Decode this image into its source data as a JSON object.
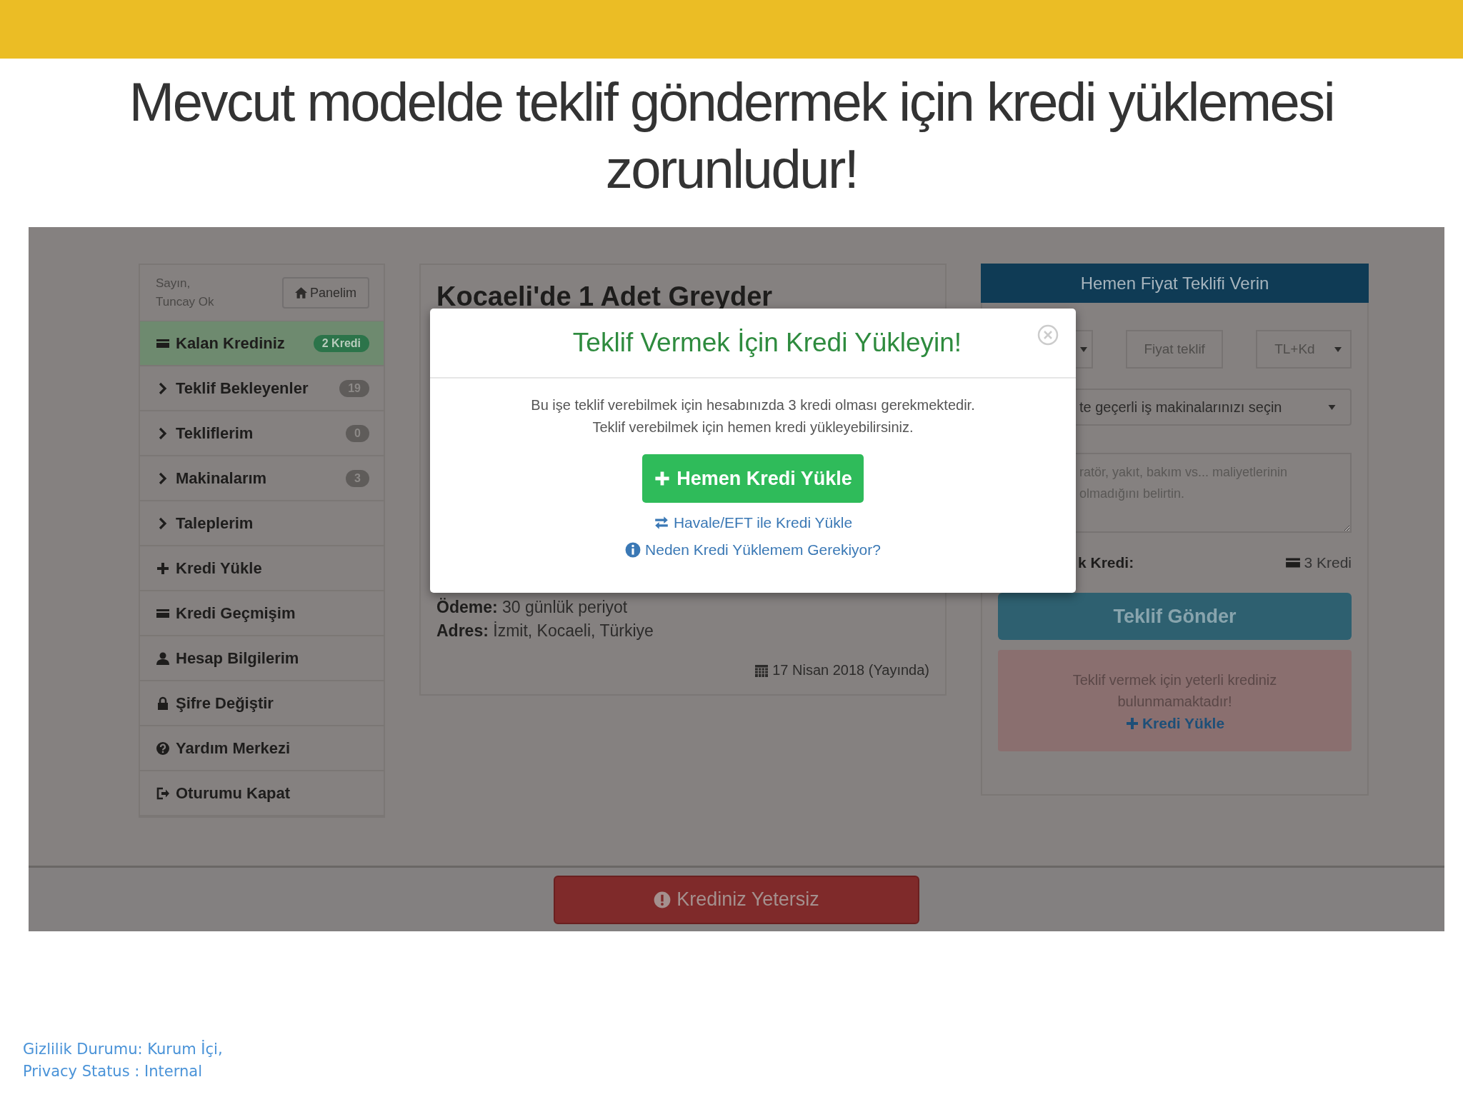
{
  "slide": {
    "title": "Mevcut modelde teklif göndermek için kredi yüklemesi zorunludur!",
    "footer": [
      "Gizlilik Durumu: Kurum İçi,",
      "Privacy Status : Internal"
    ]
  },
  "sidebar": {
    "greeting": "Sayın,",
    "user": "Tuncay Ok",
    "home_button": "Panelim",
    "items": [
      {
        "kind": "card",
        "label": "Kalan Krediniz",
        "badge": "2 Kredi",
        "selected": true
      },
      {
        "kind": "chevron",
        "label": "Teklif Bekleyenler",
        "badge": "19",
        "selected": false
      },
      {
        "kind": "chevron",
        "label": "Tekliflerim",
        "badge": "0",
        "selected": false
      },
      {
        "kind": "chevron",
        "label": "Makinalarım",
        "badge": "3",
        "selected": false
      },
      {
        "kind": "chevron",
        "label": "Taleplerim",
        "selected": false
      },
      {
        "kind": "plus",
        "label": "Kredi Yükle",
        "selected": false
      },
      {
        "kind": "card",
        "label": "Kredi Geçmişim",
        "selected": false
      },
      {
        "kind": "user",
        "label": "Hesap Bilgilerim",
        "selected": false
      },
      {
        "kind": "lock",
        "label": "Şifre Değiştir",
        "selected": false
      },
      {
        "kind": "help",
        "label": "Yardım Merkezi",
        "selected": false
      },
      {
        "kind": "logout",
        "label": "Oturumu Kapat",
        "selected": false
      }
    ]
  },
  "listing": {
    "title": "Kocaeli'de 1 Adet Greyder",
    "details": [
      {
        "label": "Ödeme:",
        "value": "30 günlük periyot"
      },
      {
        "label": "Adres:",
        "value": "İzmit, Kocaeli, Türkiye"
      }
    ],
    "date": "17 Nisan 2018 (Yayında)"
  },
  "offer_panel": {
    "title": "Hemen Fiyat Teklifi Verin",
    "price_placeholder": "Fiyat teklif",
    "currency": "TL+Kd",
    "machine_select": "te geçerli iş makinalarınızı seçin",
    "note_placeholder": "ratör, yakıt, bakım vs... maliyetlerinin\nolmadığını belirtin.",
    "credit_label": "k Kredi:",
    "credit_value": "3 Kredi",
    "submit_button": "Teklif Gönder",
    "alert": {
      "message": "Teklif vermek için yeterli krediniz bulunmamaktadır!",
      "link": "Kredi Yükle"
    }
  },
  "modal": {
    "title": "Teklif Vermek İçin Kredi Yükleyin!",
    "message_lines": [
      "Bu işe teklif verebilmek için hesabınızda 3 kredi olması gerekmektedir.",
      "Teklif verebilmek için hemen kredi yükleyebilirsiniz."
    ],
    "primary_button": "Hemen Kredi Yükle",
    "links": [
      {
        "kind": "transfer",
        "label": "Havale/EFT ile Kredi Yükle"
      },
      {
        "kind": "info",
        "label": "Neden Kredi Yüklemem Gerekiyor?"
      }
    ]
  },
  "bottom_bar": {
    "warning_button": "Krediniz Yetersiz"
  }
}
